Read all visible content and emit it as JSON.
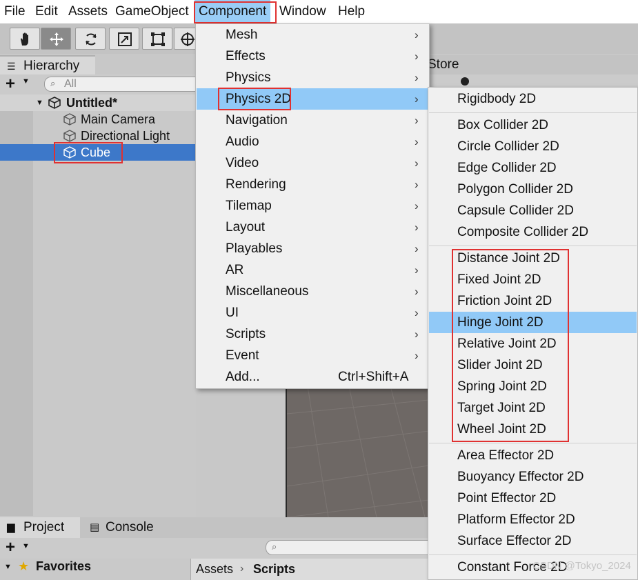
{
  "menubar": {
    "items": [
      "File",
      "Edit",
      "Assets",
      "GameObject",
      "Component",
      "Window",
      "Help"
    ]
  },
  "hierarchy": {
    "tab_label": "Hierarchy",
    "search_placeholder": "All",
    "scene_name": "Untitled*",
    "items": [
      "Main Camera",
      "Directional Light",
      "Cube"
    ],
    "selected": "Cube"
  },
  "store_tab": "Store",
  "component_menu": {
    "items": [
      {
        "label": "Mesh",
        "submenu": true
      },
      {
        "label": "Effects",
        "submenu": true
      },
      {
        "label": "Physics",
        "submenu": true
      },
      {
        "label": "Physics 2D",
        "submenu": true
      },
      {
        "label": "Navigation",
        "submenu": true
      },
      {
        "label": "Audio",
        "submenu": true
      },
      {
        "label": "Video",
        "submenu": true
      },
      {
        "label": "Rendering",
        "submenu": true
      },
      {
        "label": "Tilemap",
        "submenu": true
      },
      {
        "label": "Layout",
        "submenu": true
      },
      {
        "label": "Playables",
        "submenu": true
      },
      {
        "label": "AR",
        "submenu": true
      },
      {
        "label": "Miscellaneous",
        "submenu": true
      },
      {
        "label": "UI",
        "submenu": true
      },
      {
        "label": "Scripts",
        "submenu": true
      },
      {
        "label": "Event",
        "submenu": true
      },
      {
        "label": "Add...",
        "shortcut": "Ctrl+Shift+A"
      }
    ],
    "highlighted": "Physics 2D"
  },
  "physics2d_menu": {
    "groups": [
      [
        "Rigidbody 2D"
      ],
      [
        "Box Collider 2D",
        "Circle Collider 2D",
        "Edge Collider 2D",
        "Polygon Collider 2D",
        "Capsule Collider 2D",
        "Composite Collider 2D"
      ],
      [
        "Distance Joint 2D",
        "Fixed Joint 2D",
        "Friction Joint 2D",
        "Hinge Joint 2D",
        "Relative Joint 2D",
        "Slider Joint 2D",
        "Spring Joint 2D",
        "Target Joint 2D",
        "Wheel Joint 2D"
      ],
      [
        "Area Effector 2D",
        "Buoyancy Effector 2D",
        "Point Effector 2D",
        "Platform Effector 2D",
        "Surface Effector 2D"
      ],
      [
        "Constant Force 2D"
      ]
    ],
    "highlighted": "Hinge Joint 2D"
  },
  "bottom": {
    "tabs": [
      "Project",
      "Console"
    ],
    "favorites_label": "Favorites",
    "breadcrumb": [
      "Assets",
      "Scripts"
    ]
  },
  "watermark": "CSDN @Tokyo_2024",
  "colors": {
    "highlight": "#91c9f7",
    "selection": "#3d78c9",
    "annotation_box": "#e03131"
  },
  "icons": {
    "tools": [
      "hand-tool-icon",
      "move-tool-icon",
      "rotate-tool-icon",
      "scale-tool-icon",
      "rect-tool-icon",
      "transform-tool-icon"
    ],
    "hierarchy_item": "cube-icon",
    "scene": "unity-logo-icon"
  }
}
